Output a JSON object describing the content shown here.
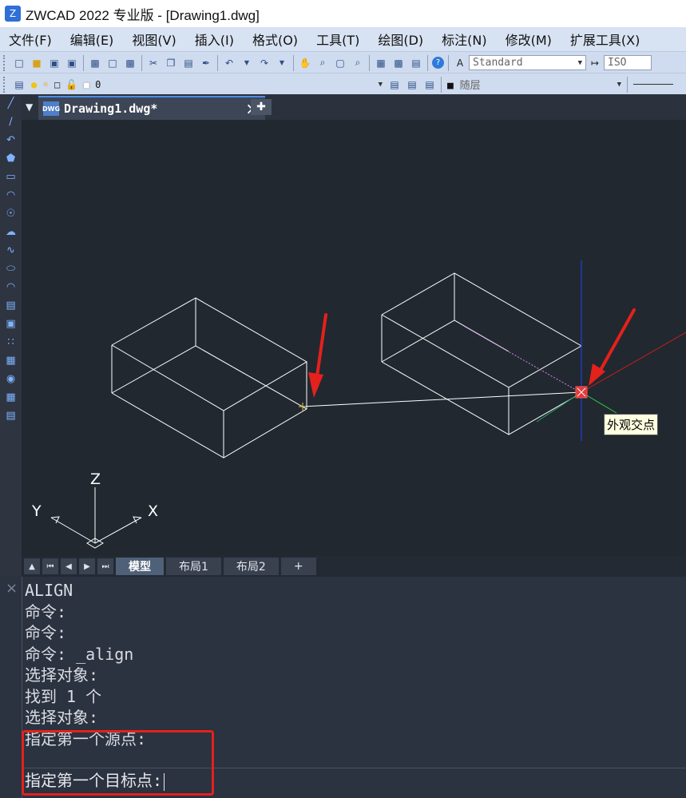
{
  "window": {
    "title": "ZWCAD 2022 专业版 - [Drawing1.dwg]"
  },
  "menu": {
    "items": [
      "文件(F)",
      "编辑(E)",
      "视图(V)",
      "插入(I)",
      "格式(O)",
      "工具(T)",
      "绘图(D)",
      "标注(N)",
      "修改(M)",
      "扩展工具(X)"
    ]
  },
  "toolbar": {
    "text_style": "Standard",
    "dim_style": "ISO",
    "layer_name": "0",
    "color_value": "随层"
  },
  "tabs": {
    "document": "Drawing1.dwg*",
    "layouts": [
      "模型",
      "布局1",
      "布局2",
      "+"
    ]
  },
  "canvas": {
    "tooltip": "外观交点",
    "ucs": {
      "x": "X",
      "y": "Y",
      "z": "Z"
    },
    "colors": {
      "background": "#212830",
      "line": "#ffffff",
      "arrow": "#e4211b",
      "snap_marker": "#ff2a2a"
    }
  },
  "command": {
    "history": [
      "ALIGN",
      "命令:",
      "命令:",
      "命令: _align",
      "选择对象:",
      "找到 1 个",
      "选择对象:",
      "指定第一个源点:"
    ],
    "prompt": "指定第一个目标点:"
  }
}
